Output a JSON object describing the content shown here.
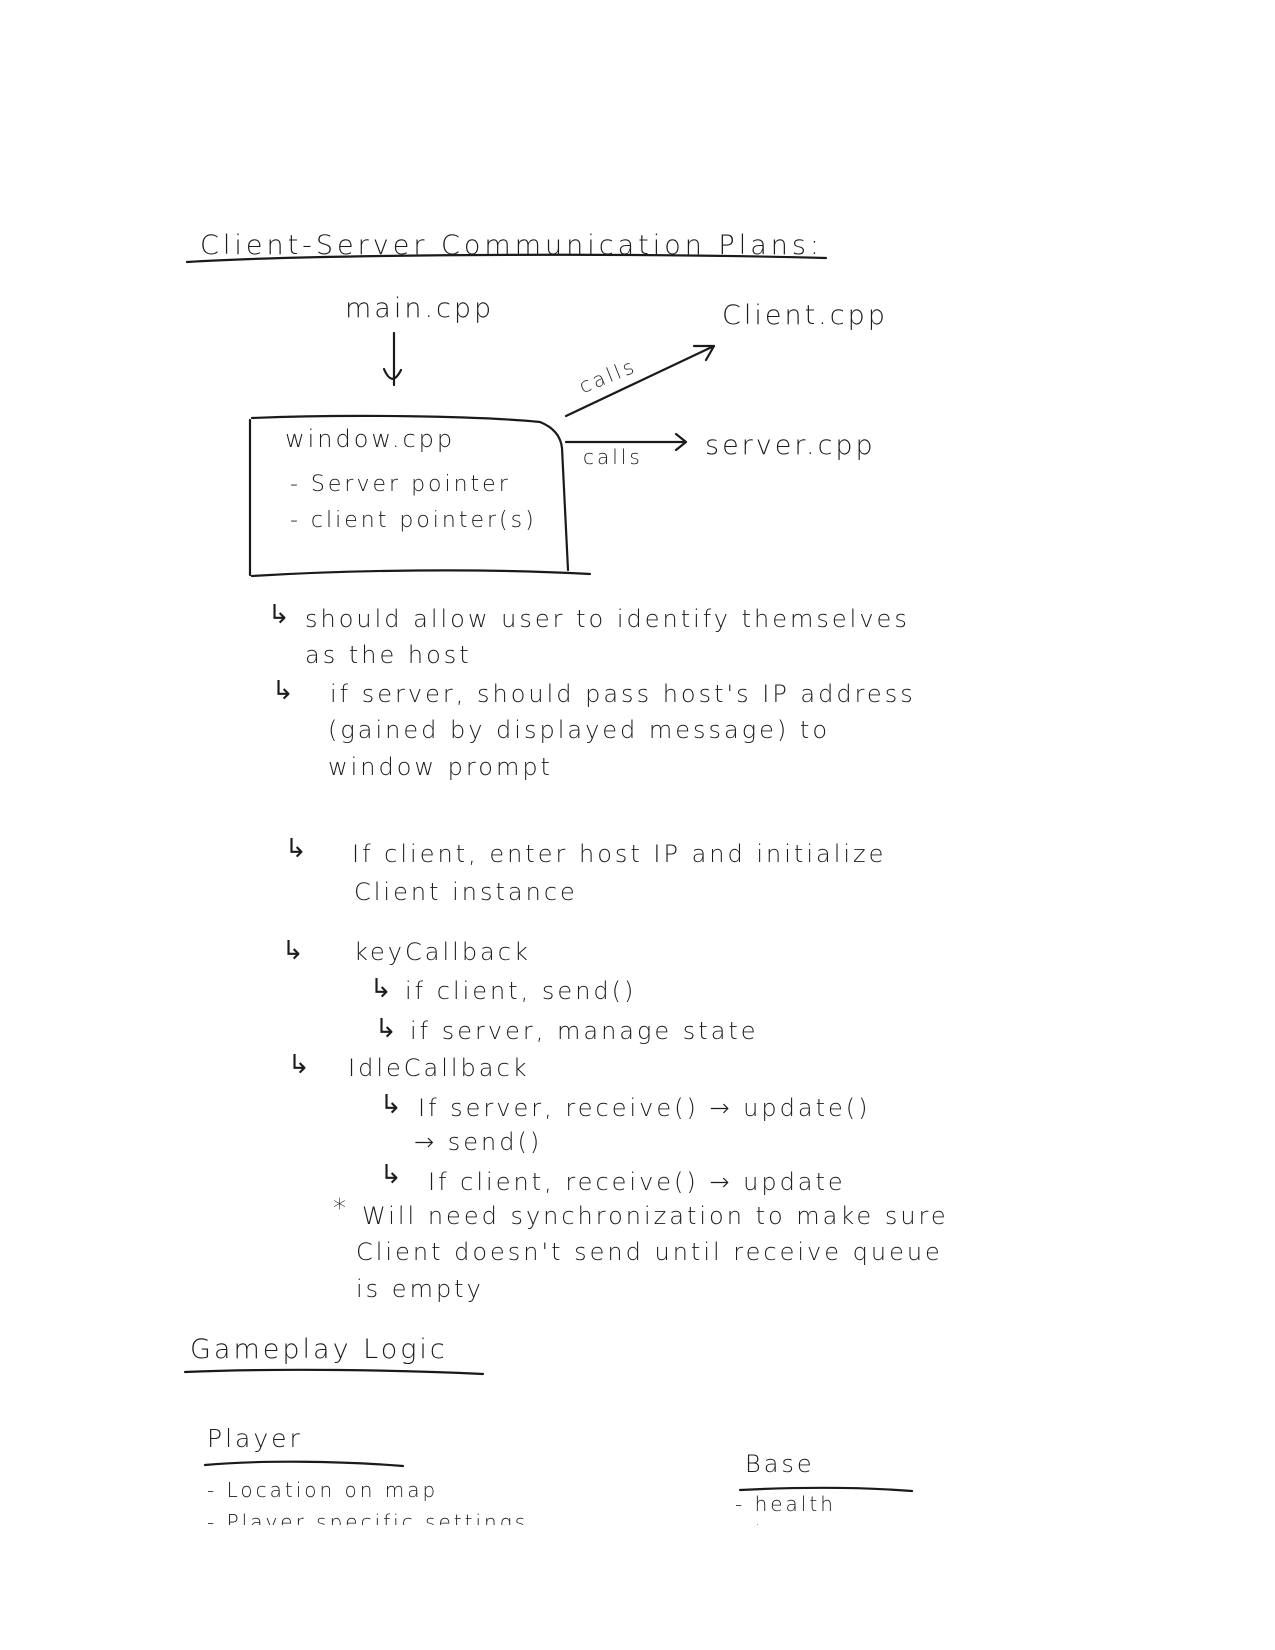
{
  "page": {
    "title": "Client-Server Communication Plans:",
    "diagram": {
      "entry": "main.cpp",
      "window_box": {
        "label": "window.cpp",
        "items": [
          "- Server pointer",
          "- client pointer(s)"
        ]
      },
      "targets": [
        {
          "label": "Client.cpp",
          "edge_label": "calls"
        },
        {
          "label": "server.cpp",
          "edge_label": "calls"
        }
      ]
    },
    "notes": [
      {
        "arrow": "↳",
        "lines": [
          "should allow user to identify themselves",
          "as the host"
        ]
      },
      {
        "arrow": "↳",
        "lines": [
          "if server, should pass host's IP address",
          "(gained by displayed message) to",
          "window prompt"
        ]
      },
      {
        "arrow": "↳",
        "lines": [
          "If client, enter host IP and initialize",
          "Client instance"
        ]
      },
      {
        "arrow": "↳",
        "title": "keyCallback",
        "subitems": [
          {
            "arrow": "↳",
            "text": "if client, send()"
          },
          {
            "arrow": "↳",
            "text": "if server, manage state"
          }
        ]
      },
      {
        "arrow": "↳",
        "title": "IdleCallback",
        "subitems": [
          {
            "arrow": "↳",
            "text": "If server, receive() → update()",
            "continuation": "→ send()"
          },
          {
            "arrow": "↳",
            "text": "If client, receive() → update"
          }
        ]
      }
    ],
    "footnote": {
      "marker": "*",
      "lines": [
        "Will need synchronization to make sure",
        "Client doesn't send until receive queue",
        "is empty"
      ]
    },
    "gameplay": {
      "title": "Gameplay Logic",
      "player": {
        "title": "Player",
        "items": [
          "- Location on map",
          "- Player specific settings"
        ]
      },
      "base": {
        "title": "Base",
        "items": [
          "- health",
          "- team"
        ]
      }
    }
  }
}
